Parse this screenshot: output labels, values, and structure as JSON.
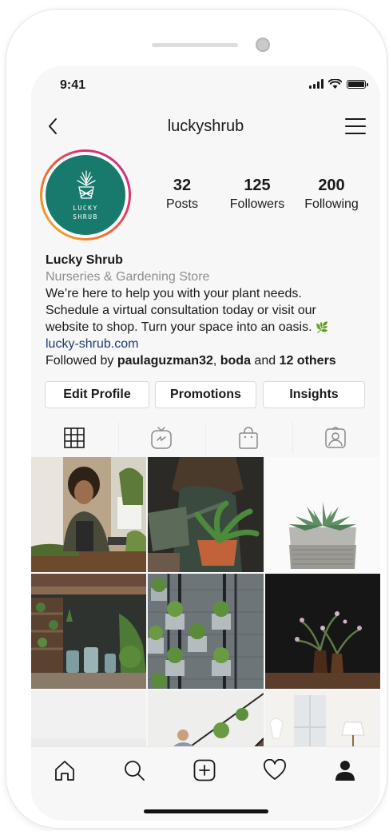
{
  "status": {
    "time": "9:41"
  },
  "header": {
    "username": "luckyshrub"
  },
  "avatar": {
    "logo_line1": "LUCKY",
    "logo_line2": "SHRUB",
    "bg_color": "#187a6d"
  },
  "stats": [
    {
      "value": "32",
      "label": "Posts"
    },
    {
      "value": "125",
      "label": "Followers"
    },
    {
      "value": "200",
      "label": "Following"
    }
  ],
  "bio": {
    "name": "Lucky Shrub",
    "category": "Nurseries & Gardening Store",
    "text_line1": "We’re here to help you with your plant needs.",
    "text_line2": "Schedule a virtual consultation today or visit our",
    "text_line3": "website to shop. Turn your space into an oasis.",
    "emoji": "🌿",
    "link": "lucky-shrub.com",
    "followed_prefix": "Followed by ",
    "followed_user1": "paulaguzman32",
    "followed_sep": ", ",
    "followed_user2": "boda",
    "followed_mid": " and ",
    "followed_others": "12 others"
  },
  "buttons": {
    "edit_profile": "Edit Profile",
    "promotions": "Promotions",
    "insights": "Insights"
  },
  "tabs": [
    "grid-icon",
    "igtv-icon",
    "shop-bag-icon",
    "tagged-icon"
  ],
  "grid_posts": [
    "man-at-counter",
    "watering-can-plant",
    "succulent-pot",
    "garden-shop",
    "wall-planters",
    "dark-flowers",
    "white-wall",
    "stairs-plants",
    "bright-room"
  ],
  "bottom_nav": [
    "home-icon",
    "search-icon",
    "new-post-icon",
    "heart-icon",
    "profile-icon"
  ],
  "colors": {
    "accent": "#1f3b73",
    "secondary_text": "#8e8e8e",
    "brand_teal": "#187a6d"
  }
}
